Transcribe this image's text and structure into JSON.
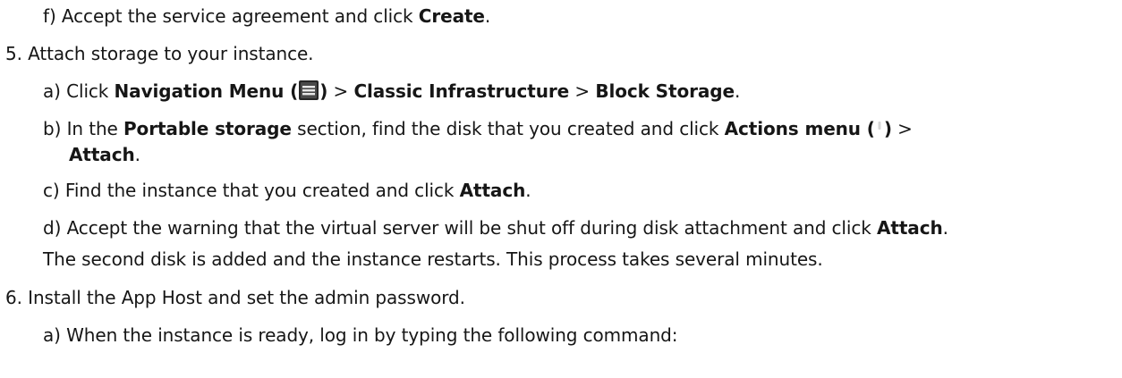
{
  "steps": {
    "step4f": {
      "marker": "f)",
      "text_before": "Accept the service agreement and click ",
      "bold": "Create",
      "text_after": "."
    },
    "step5": {
      "marker": "5.",
      "text": "Attach storage to your instance."
    },
    "step5a": {
      "marker": "a)",
      "text_before": "Click ",
      "bold1": "Navigation Menu (",
      "bold1_close": ")",
      "sep1": " > ",
      "bold2": "Classic Infrastructure",
      "sep2": " > ",
      "bold3": "Block Storage",
      "text_after": "."
    },
    "step5b": {
      "marker": "b)",
      "text_before": "In the ",
      "bold1": "Portable storage",
      "text_middle": " section, find the disk that you created and click ",
      "bold2": "Actions menu (",
      "bold2_close": ")",
      "sep": " >",
      "bold3": "Attach",
      "text_after": "."
    },
    "step5c": {
      "marker": "c)",
      "text_before": "Find the instance that you created and click ",
      "bold": "Attach",
      "text_after": "."
    },
    "step5d": {
      "marker": "d)",
      "text_before": "Accept the warning that the virtual server will be shut off during disk attachment and click ",
      "bold": "Attach",
      "text_after": "."
    },
    "step5_result": {
      "text": "The second disk is added and the instance restarts. This process takes several minutes."
    },
    "step6": {
      "marker": "6.",
      "text": "Install the App Host and set the admin password."
    },
    "step6a": {
      "marker": "a)",
      "text": "When the instance is ready, log in by typing the following command:"
    }
  },
  "icons": {
    "navigation_menu": "hamburger-menu-icon",
    "actions_menu": "overflow-menu-vertical-icon"
  }
}
